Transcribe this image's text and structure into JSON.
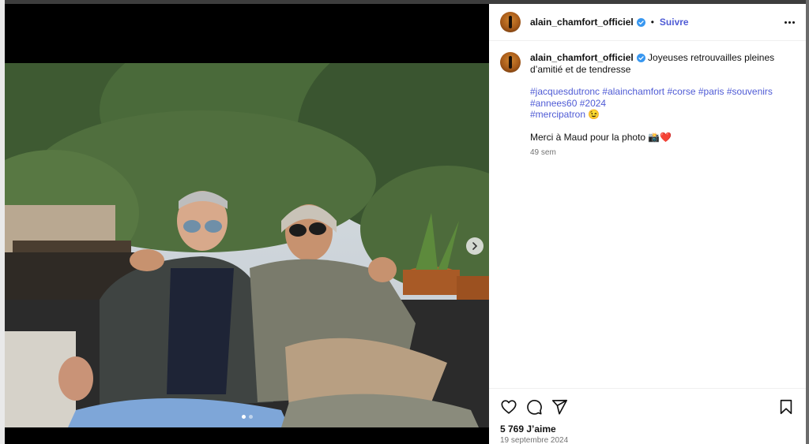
{
  "post": {
    "username": "alain_chamfort_officiel",
    "separator": "•",
    "follow_label": "Suivre",
    "caption_text": " Joyeuses retrouvailles pleines d’amitié et de tendresse",
    "hashtags": [
      "#jacquesdutronc",
      "#alainchamfort",
      "#corse",
      "#paris",
      "#souvenirs",
      "#annees60",
      "#2024",
      "#mercipatron"
    ],
    "hashtag_emoji": "😉",
    "thanks_text": "Merci à Maud pour la photo 📸❤️",
    "time_ago": "49 sem",
    "likes": "5 769 J’aime",
    "date": "19 septembre 2024"
  },
  "carousel": {
    "dots": 2,
    "active_index": 0
  },
  "icons": {
    "like": "heart-icon",
    "comment": "comment-icon",
    "share": "share-icon",
    "save": "bookmark-icon",
    "next": "chevron-right-icon",
    "more": "more-icon",
    "verified": "verified-badge-icon"
  },
  "colors": {
    "link": "#4f5bd5",
    "verified": "#3897f0",
    "muted": "#737373"
  }
}
